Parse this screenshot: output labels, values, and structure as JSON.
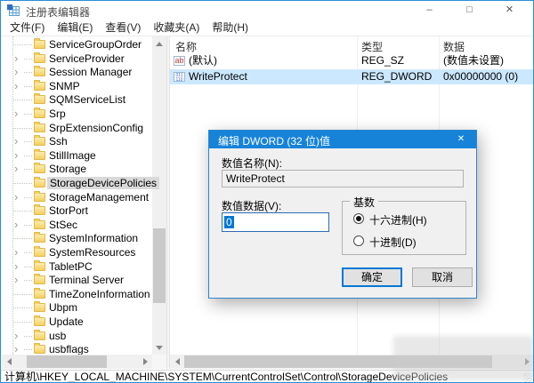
{
  "window": {
    "title": "注册表编辑器",
    "controls": {
      "minimize": "–",
      "maximize": "□",
      "close": "✕"
    }
  },
  "menu": {
    "items": [
      "文件(F)",
      "编辑(E)",
      "查看(V)",
      "收藏夹(A)",
      "帮助(H)"
    ]
  },
  "tree": {
    "items": [
      {
        "label": "ServiceGroupOrder",
        "expandable": false,
        "selected": false
      },
      {
        "label": "ServiceProvider",
        "expandable": true,
        "selected": false
      },
      {
        "label": "Session Manager",
        "expandable": true,
        "selected": false
      },
      {
        "label": "SNMP",
        "expandable": true,
        "selected": false
      },
      {
        "label": "SQMServiceList",
        "expandable": false,
        "selected": false
      },
      {
        "label": "Srp",
        "expandable": true,
        "selected": false
      },
      {
        "label": "SrpExtensionConfig",
        "expandable": false,
        "selected": false
      },
      {
        "label": "Ssh",
        "expandable": true,
        "selected": false
      },
      {
        "label": "StillImage",
        "expandable": true,
        "selected": false
      },
      {
        "label": "Storage",
        "expandable": true,
        "selected": false
      },
      {
        "label": "StorageDevicePolicies",
        "expandable": false,
        "selected": true
      },
      {
        "label": "StorageManagement",
        "expandable": true,
        "selected": false
      },
      {
        "label": "StorPort",
        "expandable": false,
        "selected": false
      },
      {
        "label": "StSec",
        "expandable": true,
        "selected": false
      },
      {
        "label": "SystemInformation",
        "expandable": false,
        "selected": false
      },
      {
        "label": "SystemResources",
        "expandable": true,
        "selected": false
      },
      {
        "label": "TabletPC",
        "expandable": true,
        "selected": false
      },
      {
        "label": "Terminal Server",
        "expandable": true,
        "selected": false
      },
      {
        "label": "TimeZoneInformation",
        "expandable": false,
        "selected": false
      },
      {
        "label": "Ubpm",
        "expandable": false,
        "selected": false
      },
      {
        "label": "Update",
        "expandable": false,
        "selected": false
      },
      {
        "label": "usb",
        "expandable": true,
        "selected": false
      },
      {
        "label": "usbflags",
        "expandable": true,
        "selected": false
      }
    ]
  },
  "list": {
    "headers": [
      "名称",
      "类型",
      "数据"
    ],
    "rows": [
      {
        "icon": "reg-sz-icon",
        "name": "(默认)",
        "type": "REG_SZ",
        "data": "(数值未设置)",
        "selected": false
      },
      {
        "icon": "reg-dword-icon",
        "name": "WriteProtect",
        "type": "REG_DWORD",
        "data": "0x00000000 (0)",
        "selected": true
      }
    ]
  },
  "dialog": {
    "title": "编辑 DWORD (32 位)值",
    "close": "✕",
    "name_label": "数值名称(N):",
    "name_value": "WriteProtect",
    "data_label": "数值数据(V):",
    "data_value": "0",
    "base_label": "基数",
    "radios": [
      {
        "label": "十六进制(H)",
        "selected": true
      },
      {
        "label": "十进制(D)",
        "selected": false
      }
    ],
    "ok_label": "确定",
    "cancel_label": "取消"
  },
  "statusbar": {
    "path": "计算机\\HKEY_LOCAL_MACHINE\\SYSTEM\\CurrentControlSet\\Control\\StorageDevicePolicies"
  },
  "colors": {
    "accent_blue": "#1683d9",
    "window_border": "#2a8ed6",
    "list_selection": "#cce8ff",
    "tree_selection_inactive": "#d9d9d9",
    "text_selection": "#0078d7"
  }
}
